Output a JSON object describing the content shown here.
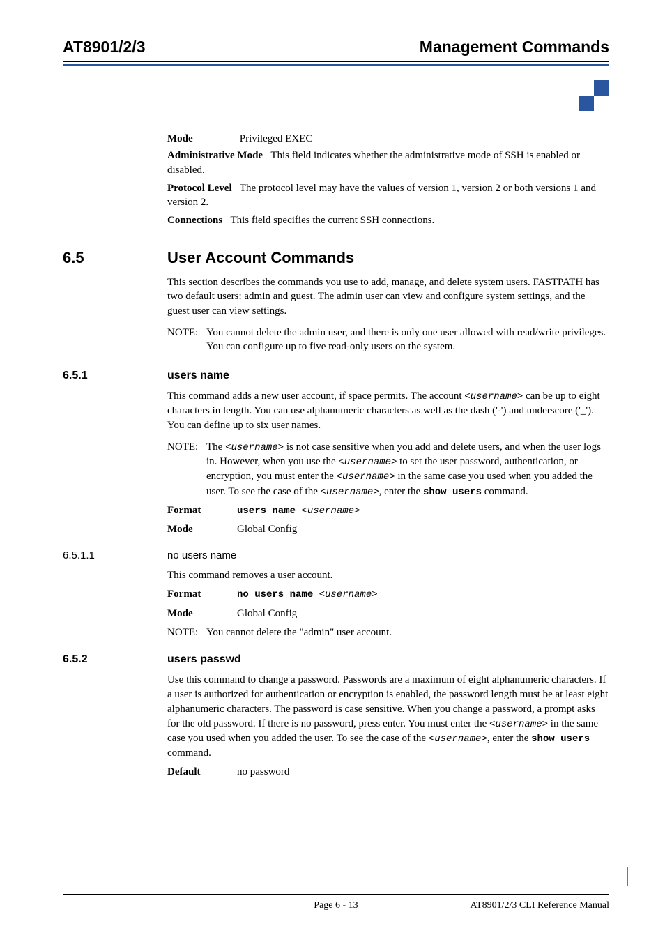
{
  "header": {
    "left": "AT8901/2/3",
    "right": "Management Commands"
  },
  "top_block": {
    "mode_label": "Mode",
    "mode_value": "Privileged EXEC",
    "admin_label": "Administrative Mode",
    "admin_text": "This field indicates whether the administrative mode of SSH is enabled or disabled.",
    "protocol_label": "Protocol Level",
    "protocol_text": "The protocol level may have the values of version 1, version 2 or both versions 1 and version 2.",
    "connections_label": "Connections",
    "connections_text": "This field specifies the current SSH connections."
  },
  "sec_6_5": {
    "num": "6.5",
    "title": "User Account Commands",
    "para": "This section describes the commands you use to add, manage, and delete system users. FASTPATH has two default users: admin and guest. The admin user can view and configure system settings, and the guest user can view settings.",
    "note_label": "NOTE:",
    "note_text": "You cannot delete the admin user, and there is only one user allowed with read/write privileges. You can configure up to five read-only users on the system."
  },
  "sec_6_5_1": {
    "num": "6.5.1",
    "title": "users name",
    "para1_a": "This command adds a new user account, if space permits. The account ",
    "para1_b": " can be up to eight characters in length. You can use alphanumeric characters as well as the dash ('-') and underscore ('_'). You can define up to six user names.",
    "note_label": "NOTE:",
    "note_a": "The ",
    "note_b": " is not case sensitive when you add and delete users, and when the user logs in. However, when you use the ",
    "note_c": " to set the user password, authentication, or encryption, you must enter the ",
    "note_d": " in the same case you used when you added the user. To see the case of the ",
    "note_e": ", enter the ",
    "note_f": " command.",
    "format_label": "Format",
    "format_cmd": "users name ",
    "mode_label": "Mode",
    "mode_value": "Global Config"
  },
  "sec_6_5_1_1": {
    "num": "6.5.1.1",
    "title": "no users name",
    "para": "This command removes a user account.",
    "format_label": "Format",
    "format_cmd": "no users name ",
    "mode_label": "Mode",
    "mode_value": "Global Config",
    "note_label": "NOTE:",
    "note_text": "You cannot delete the \"admin\" user account."
  },
  "sec_6_5_2": {
    "num": "6.5.2",
    "title": "users passwd",
    "para_a": "Use this command to change a password. Passwords are a maximum of eight alphanumeric characters. If a user is authorized for authentication or encryption is enabled, the password length must be at least eight alphanumeric characters. The password is case sensitive. When you change a password, a prompt asks for the old password. If there is no password, press enter. You must enter the ",
    "para_b": " in the same case you used when you added the user. To see the case of the ",
    "para_c": ", enter the ",
    "para_d": " command.",
    "default_label": "Default",
    "default_value": "no password"
  },
  "tokens": {
    "username": "<username>",
    "show_users": "show users"
  },
  "footer": {
    "page": "Page 6 - 13",
    "manual": "AT8901/2/3 CLI Reference Manual"
  }
}
